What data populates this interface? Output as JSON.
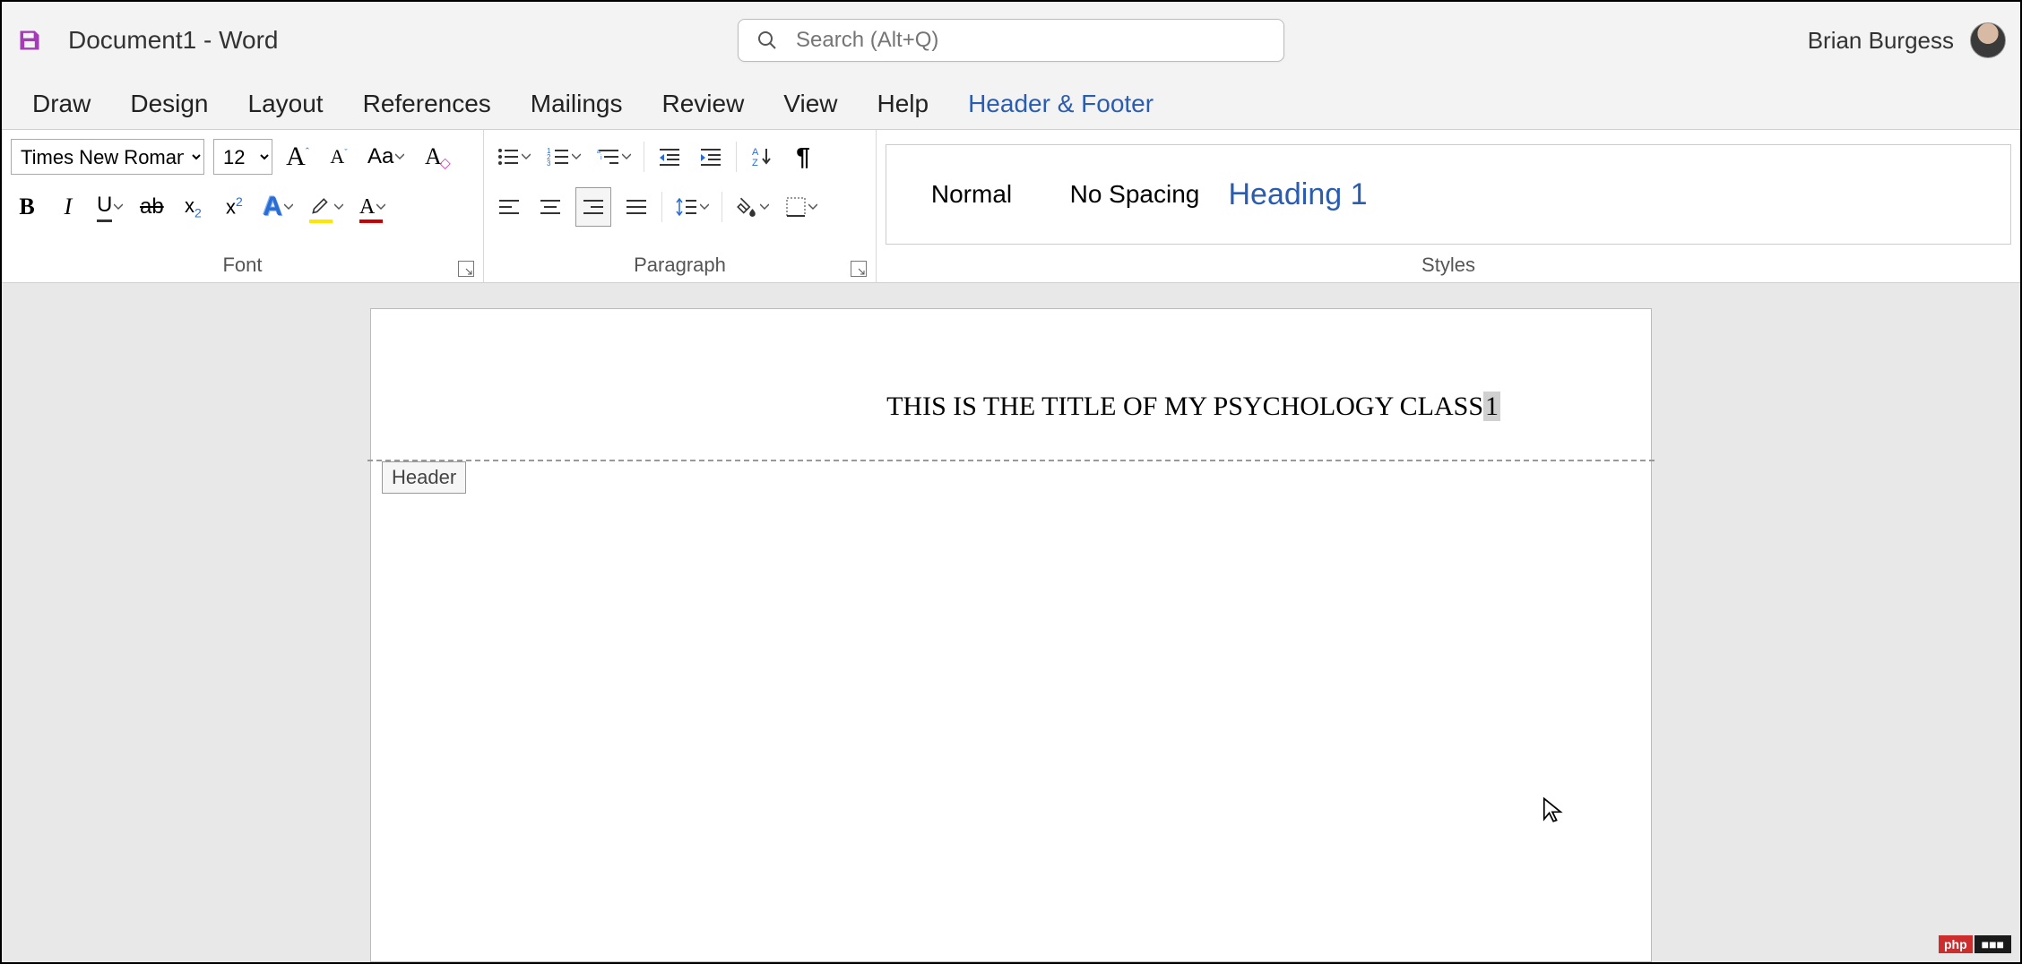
{
  "title_bar": {
    "doc_title": "Document1  -  Word",
    "search_placeholder": "Search (Alt+Q)",
    "user_name": "Brian Burgess"
  },
  "tabs": {
    "items": [
      {
        "label": "Draw",
        "active": false
      },
      {
        "label": "Design",
        "active": false
      },
      {
        "label": "Layout",
        "active": false
      },
      {
        "label": "References",
        "active": false
      },
      {
        "label": "Mailings",
        "active": false
      },
      {
        "label": "Review",
        "active": false
      },
      {
        "label": "View",
        "active": false
      },
      {
        "label": "Help",
        "active": false
      },
      {
        "label": "Header & Footer",
        "active": true
      }
    ]
  },
  "ribbon": {
    "font": {
      "label": "Font",
      "font_name": "Times New Roman",
      "font_size": "12",
      "grow_label": "A",
      "shrink_label": "A",
      "case_label": "Aa",
      "bold": "B",
      "italic": "I",
      "underline": "U",
      "strike": "ab",
      "subscript_base": "x",
      "subscript_sub": "2",
      "superscript_base": "x",
      "superscript_sup": "2",
      "text_effects": "A",
      "highlight_color": "#ffe600",
      "font_color": "#cc0000"
    },
    "paragraph": {
      "label": "Paragraph"
    },
    "styles": {
      "label": "Styles",
      "items": [
        {
          "label": "Normal"
        },
        {
          "label": "No Spacing"
        },
        {
          "label": "Heading 1"
        }
      ]
    }
  },
  "document": {
    "header_text": "THIS IS THE TITLE OF MY PSYCHOLOGY CLASS",
    "page_number": "1",
    "header_badge": "Header"
  },
  "watermark": {
    "left": "php",
    "right": "■■■"
  },
  "icons": {
    "save": "save-icon",
    "search": "search-icon",
    "caret": "caret-down-icon"
  }
}
